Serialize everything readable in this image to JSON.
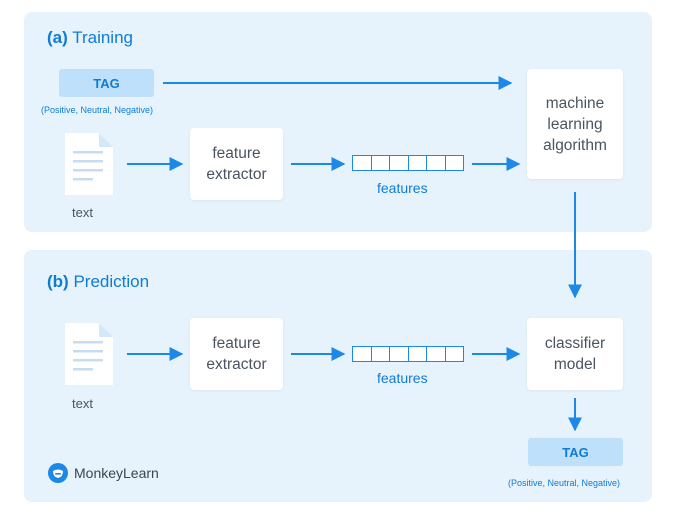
{
  "colors": {
    "panel_bg": "#e6f3fd",
    "accent": "#0f7bd6",
    "arrow": "#1d88e5",
    "tag_bg": "#bfe0fa",
    "box_text": "#4a5561"
  },
  "training": {
    "title_prefix": "(a)",
    "title": "Training",
    "tag": {
      "label": "TAG",
      "caption": "(Positive, Neutral, Negative)"
    },
    "document": {
      "icon": "document-icon",
      "label": "text"
    },
    "feature_extractor": {
      "line1": "feature",
      "line2": "extractor"
    },
    "features": {
      "label": "features",
      "cells": 6
    },
    "algorithm": {
      "line1": "machine",
      "line2": "learning",
      "line3": "algorithm"
    }
  },
  "prediction": {
    "title_prefix": "(b)",
    "title": "Prediction",
    "document": {
      "icon": "document-icon",
      "label": "text"
    },
    "feature_extractor": {
      "line1": "feature",
      "line2": "extractor"
    },
    "features": {
      "label": "features",
      "cells": 6
    },
    "classifier": {
      "line1": "classifier",
      "line2": "model"
    },
    "tag": {
      "label": "TAG",
      "caption": "(Positive, Neutral, Negative)"
    }
  },
  "brand": {
    "name": "MonkeyLearn",
    "icon": "monkeylearn-logo-icon"
  }
}
